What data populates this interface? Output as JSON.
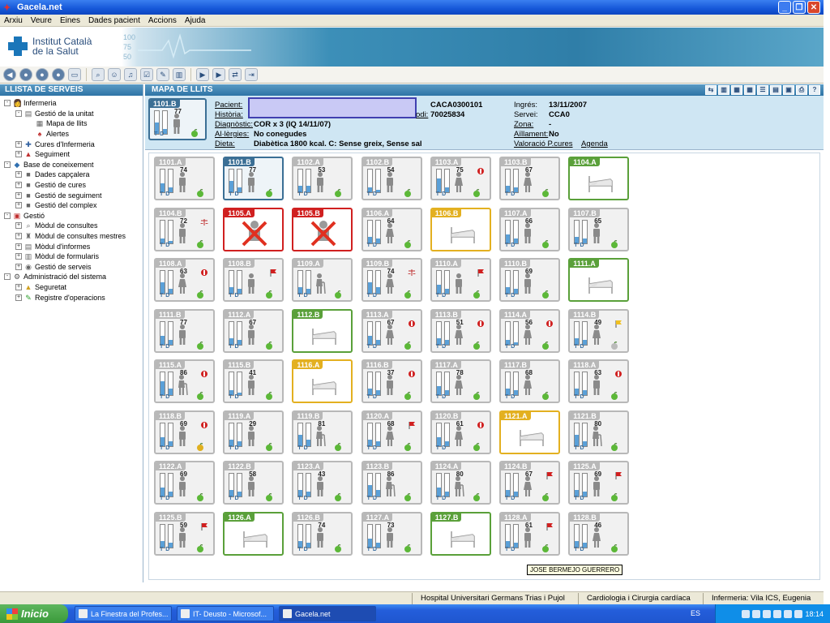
{
  "window": {
    "title": "Gacela.net"
  },
  "menu": [
    "Arxiu",
    "Veure",
    "Eines",
    "Dades pacient",
    "Accions",
    "Ajuda"
  ],
  "banner": {
    "line1": "Institut Català",
    "line2": "de la Salut",
    "scale": [
      "100",
      "75",
      "50"
    ]
  },
  "sidebar": {
    "title": "LLISTA DE SERVEIS",
    "items": [
      {
        "label": "Infermeria",
        "level": 0,
        "exp": "-",
        "icon": "nurse-icon"
      },
      {
        "label": "Gestió de la unitat",
        "level": 1,
        "exp": "-",
        "icon": "unit-icon"
      },
      {
        "label": "Mapa de llits",
        "level": 2,
        "exp": "",
        "icon": "map-icon"
      },
      {
        "label": "Alertes",
        "level": 2,
        "exp": "",
        "icon": "bell-icon"
      },
      {
        "label": "Cures d'Infermeria",
        "level": 1,
        "exp": "+",
        "icon": "care-icon"
      },
      {
        "label": "Seguiment",
        "level": 1,
        "exp": "+",
        "icon": "chart-icon"
      },
      {
        "label": "Base de coneixement",
        "level": 0,
        "exp": "-",
        "icon": "knowledge-icon"
      },
      {
        "label": "Dades capçalera",
        "level": 1,
        "exp": "+",
        "icon": "folder-icon"
      },
      {
        "label": "Gestió de cures",
        "level": 1,
        "exp": "+",
        "icon": "folder-icon"
      },
      {
        "label": "Gestió de seguiment",
        "level": 1,
        "exp": "+",
        "icon": "folder-icon"
      },
      {
        "label": "Gestió del complex",
        "level": 1,
        "exp": "+",
        "icon": "folder-icon"
      },
      {
        "label": "Gestió",
        "level": 0,
        "exp": "-",
        "icon": "toolbox-icon"
      },
      {
        "label": "Mòdul de consultes",
        "level": 1,
        "exp": "+",
        "icon": "search-icon"
      },
      {
        "label": "Mòdul de consultes mestres",
        "level": 1,
        "exp": "+",
        "icon": "master-icon"
      },
      {
        "label": "Mòdul d'informes",
        "level": 1,
        "exp": "+",
        "icon": "report-icon"
      },
      {
        "label": "Mòdul de formularis",
        "level": 1,
        "exp": "+",
        "icon": "form-icon"
      },
      {
        "label": "Gestió de serveis",
        "level": 1,
        "exp": "+",
        "icon": "service-icon"
      },
      {
        "label": "Administració del sistema",
        "level": 0,
        "exp": "-",
        "icon": "admin-icon"
      },
      {
        "label": "Seguretat",
        "level": 1,
        "exp": "+",
        "icon": "lock-icon"
      },
      {
        "label": "Registre d'operacions",
        "level": 1,
        "exp": "+",
        "icon": "log-icon"
      }
    ]
  },
  "main": {
    "title": "MAPA DE LLITS"
  },
  "patient": {
    "bed_label": "1101.B",
    "bed_num": "77",
    "labels": {
      "pacient": "Pacient:",
      "historia": "Història:",
      "diagnostic": "Diagnòstic:",
      "allergies": "Al·lèrgies:",
      "dieta": "Dieta:",
      "codi": "odi:",
      "ingres": "Ingrés:",
      "servei": "Servei:",
      "zona": "Zona:",
      "aillament": "Aïllament:",
      "valoracio": "Valoració P.cures",
      "agenda": "Agenda"
    },
    "values": {
      "code1": "CACA0300101",
      "codi": "70025834",
      "diagnostic": "COR x 3 (IQ 14/11/07)",
      "allergies": "No conegudes",
      "dieta": "Diabètica 1800 kcal. C: Sense greix, Sense sal",
      "ingres": "13/11/2007",
      "servei": "CCA0",
      "zona": "-",
      "aillament": "No"
    }
  },
  "beds": [
    {
      "id": "1101.A",
      "state": "occ",
      "num": "74",
      "fig": "person",
      "apple": "green",
      "b1": 0.4,
      "b2": 0.2
    },
    {
      "id": "1101.B",
      "state": "sel",
      "num": "77",
      "fig": "person",
      "apple": "green",
      "b1": 0.5,
      "b2": 0.2
    },
    {
      "id": "1102.A",
      "state": "occ",
      "num": "53",
      "fig": "person",
      "apple": "green",
      "b1": 0.3,
      "b2": 0.3
    },
    {
      "id": "1102.B",
      "state": "occ",
      "num": "54",
      "fig": "person",
      "apple": "green",
      "b1": 0.2,
      "b2": 0.1
    },
    {
      "id": "1103.A",
      "state": "occ",
      "num": "75",
      "fig": "woman",
      "apple": "green",
      "mark": "red-dot",
      "b1": 0.6,
      "b2": 0.2
    },
    {
      "id": "1103.B",
      "state": "occ",
      "num": "67",
      "fig": "woman",
      "apple": "green",
      "b1": 0.3,
      "b2": 0.2
    },
    {
      "id": "1104.A",
      "state": "free"
    },
    {
      "id": "1104.B",
      "state": "occ",
      "num": "72",
      "fig": "person",
      "apple": "green",
      "mark": "scale",
      "b1": 0.2,
      "b2": 0.1
    },
    {
      "id": "1105.A",
      "state": "blk"
    },
    {
      "id": "1105.B",
      "state": "blk"
    },
    {
      "id": "1106.A",
      "state": "occ",
      "num": "64",
      "fig": "woman",
      "apple": "green",
      "b1": 0.3,
      "b2": 0.2
    },
    {
      "id": "1106.B",
      "state": "yel"
    },
    {
      "id": "1107.A",
      "state": "occ",
      "num": "66",
      "fig": "person",
      "apple": "green",
      "b1": 0.4,
      "b2": 0.2
    },
    {
      "id": "1107.B",
      "state": "occ",
      "num": "65",
      "fig": "person",
      "apple": "green",
      "b1": 0.3,
      "b2": 0.2
    },
    {
      "id": "1108.A",
      "state": "occ",
      "num": "63",
      "fig": "woman",
      "apple": "green",
      "mark": "red-dot",
      "b1": 0.5,
      "b2": 0.2
    },
    {
      "id": "1108.B",
      "state": "occ",
      "num": "",
      "fig": "person",
      "apple": "green",
      "mark": "red-flag",
      "b1": 0.3,
      "b2": 0.2
    },
    {
      "id": "1109.A",
      "state": "occ",
      "num": "",
      "fig": "elder",
      "apple": "green",
      "b1": 0.3,
      "b2": 0.2
    },
    {
      "id": "1109.B",
      "state": "occ",
      "num": "74",
      "fig": "woman",
      "apple": "green",
      "mark": "scale",
      "b1": 0.5,
      "b2": 0.3
    },
    {
      "id": "1110.A",
      "state": "occ",
      "num": "",
      "fig": "person",
      "apple": "green",
      "mark": "red-flag",
      "b1": 0.4,
      "b2": 0.2
    },
    {
      "id": "1110.B",
      "state": "occ",
      "num": "69",
      "fig": "person",
      "apple": "green",
      "b1": 0.3,
      "b2": 0.2
    },
    {
      "id": "1111.A",
      "state": "free"
    },
    {
      "id": "1111.B",
      "state": "occ",
      "num": "77",
      "fig": "person",
      "apple": "green",
      "b1": 0.4,
      "b2": 0.2
    },
    {
      "id": "1112.A",
      "state": "occ",
      "num": "67",
      "fig": "person",
      "apple": "green",
      "b1": 0.3,
      "b2": 0.2
    },
    {
      "id": "1112.B",
      "state": "free"
    },
    {
      "id": "1113.A",
      "state": "occ",
      "num": "67",
      "fig": "woman",
      "apple": "green",
      "mark": "red-dot",
      "b1": 0.4,
      "b2": 0.2
    },
    {
      "id": "1113.B",
      "state": "occ",
      "num": "51",
      "fig": "woman",
      "apple": "green",
      "mark": "red-dot",
      "b1": 0.3,
      "b2": 0.2
    },
    {
      "id": "1114.A",
      "state": "occ",
      "num": "56",
      "fig": "woman",
      "apple": "green",
      "mark": "red-dot",
      "b1": 0.2,
      "b2": 0.1
    },
    {
      "id": "1114.B",
      "state": "occ",
      "num": "49",
      "fig": "woman",
      "apple": "grey",
      "mark": "yellow-flag",
      "b1": 0.3,
      "b2": 0.2
    },
    {
      "id": "1115.A",
      "state": "occ",
      "num": "86",
      "fig": "elder",
      "apple": "green",
      "mark": "red-dot",
      "b1": 0.6,
      "b2": 0.3
    },
    {
      "id": "1115.B",
      "state": "occ",
      "num": "41",
      "fig": "person",
      "apple": "green",
      "b1": 0.2,
      "b2": 0.1
    },
    {
      "id": "1116.A",
      "state": "yel"
    },
    {
      "id": "1116.B",
      "state": "occ",
      "num": "37",
      "fig": "person",
      "apple": "green",
      "mark": "red-dot",
      "b1": 0.3,
      "b2": 0.2
    },
    {
      "id": "1117.A",
      "state": "occ",
      "num": "78",
      "fig": "woman",
      "apple": "green",
      "b1": 0.4,
      "b2": 0.2
    },
    {
      "id": "1117.B",
      "state": "occ",
      "num": "68",
      "fig": "woman",
      "apple": "green",
      "b1": 0.3,
      "b2": 0.2
    },
    {
      "id": "1118.A",
      "state": "occ",
      "num": "63",
      "fig": "person",
      "apple": "green",
      "mark": "red-dot",
      "b1": 0.3,
      "b2": 0.2
    },
    {
      "id": "1118.B",
      "state": "occ",
      "num": "69",
      "fig": "person",
      "apple": "yellow",
      "mark": "red-dot",
      "b1": 0.4,
      "b2": 0.2
    },
    {
      "id": "1119.A",
      "state": "occ",
      "num": "29",
      "fig": "person",
      "apple": "green",
      "b1": 0.3,
      "b2": 0.2
    },
    {
      "id": "1119.B",
      "state": "occ",
      "num": "81",
      "fig": "elder",
      "apple": "green",
      "b1": 0.5,
      "b2": 0.3
    },
    {
      "id": "1120.A",
      "state": "occ",
      "num": "68",
      "fig": "woman",
      "apple": "green",
      "mark": "red-flag",
      "b1": 0.3,
      "b2": 0.2
    },
    {
      "id": "1120.B",
      "state": "occ",
      "num": "61",
      "fig": "woman",
      "apple": "green",
      "mark": "red-dot",
      "b1": 0.4,
      "b2": 0.2
    },
    {
      "id": "1121.A",
      "state": "yel"
    },
    {
      "id": "1121.B",
      "state": "occ",
      "num": "80",
      "fig": "elder",
      "apple": "green",
      "b1": 0.5,
      "b2": 0.2
    },
    {
      "id": "1122.A",
      "state": "occ",
      "num": "69",
      "fig": "person",
      "apple": "green",
      "b1": 0.4,
      "b2": 0.2
    },
    {
      "id": "1122.B",
      "state": "occ",
      "num": "58",
      "fig": "person",
      "apple": "green",
      "b1": 0.3,
      "b2": 0.2
    },
    {
      "id": "1123.A",
      "state": "occ",
      "num": "43",
      "fig": "person",
      "apple": "green",
      "b1": 0.3,
      "b2": 0.2
    },
    {
      "id": "1123.B",
      "state": "occ",
      "num": "86",
      "fig": "elder",
      "apple": "green",
      "b1": 0.5,
      "b2": 0.3
    },
    {
      "id": "1124.A",
      "state": "occ",
      "num": "80",
      "fig": "elder",
      "apple": "green",
      "b1": 0.4,
      "b2": 0.2
    },
    {
      "id": "1124.B",
      "state": "occ",
      "num": "67",
      "fig": "woman",
      "apple": "green",
      "mark": "red-flag",
      "b1": 0.3,
      "b2": 0.2
    },
    {
      "id": "1125.A",
      "state": "occ",
      "num": "69",
      "fig": "person",
      "apple": "green",
      "mark": "red-flag",
      "b1": 0.3,
      "b2": 0.2
    },
    {
      "id": "1125.B",
      "state": "occ",
      "num": "59",
      "fig": "person",
      "apple": "green",
      "mark": "red-flag",
      "b1": 0.3,
      "b2": 0.2
    },
    {
      "id": "1126.A",
      "state": "free"
    },
    {
      "id": "1126.B",
      "state": "occ",
      "num": "74",
      "fig": "person",
      "apple": "green",
      "b1": 0.3,
      "b2": 0.2
    },
    {
      "id": "1127.A",
      "state": "occ",
      "num": "73",
      "fig": "person",
      "apple": "green",
      "b1": 0.4,
      "b2": 0.2
    },
    {
      "id": "1127.B",
      "state": "free"
    },
    {
      "id": "1128.A",
      "state": "occ",
      "num": "61",
      "fig": "person",
      "apple": "green",
      "mark": "red-flag",
      "b1": 0.3,
      "b2": 0.2
    },
    {
      "id": "1128.B",
      "state": "occ",
      "num": "46",
      "fig": "woman",
      "apple": "green",
      "b1": 0.3,
      "b2": 0.2
    }
  ],
  "tooltip": "JOSE BERMEJO GUERRERO",
  "status": {
    "hospital": "Hospital Universitari Germans Trias i Pujol",
    "service": "Cardiologia i Cirurgia cardíaca",
    "nurse": "Infermeria: Vila ICS, Eugenia"
  },
  "taskbar": {
    "start": "Inicio",
    "tasks": [
      "La Finestra del Profes...",
      "IT- Deusto - Microsof...",
      "Gacela.net"
    ],
    "lang": "ES",
    "clock": "18:14"
  },
  "colors": {
    "selected": "#3b6f95",
    "free": "#5aa03a",
    "pending": "#e3b020",
    "blocked": "#d02020",
    "occupied": "#b8b8b8"
  }
}
